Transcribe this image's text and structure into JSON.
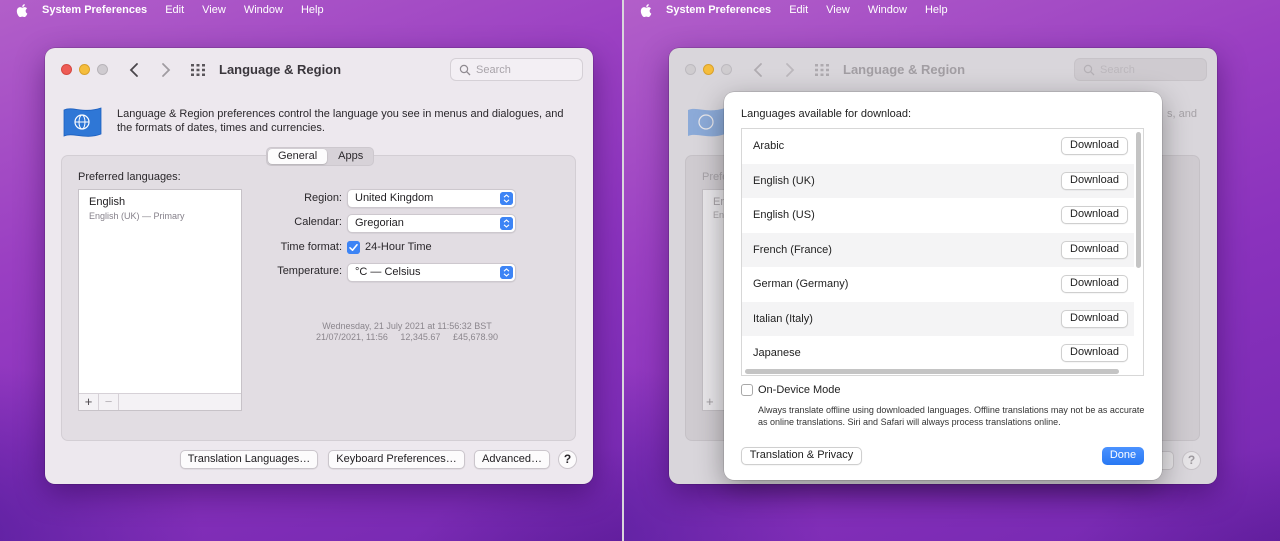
{
  "menubar": {
    "app_name": "System Preferences",
    "items": [
      "Edit",
      "View",
      "Window",
      "Help"
    ]
  },
  "window": {
    "title": "Language & Region",
    "search_placeholder": "Search",
    "description": "Language & Region preferences control the language you see in menus and dialogues, and the formats of dates, times and currencies.",
    "tabs": [
      "General",
      "Apps"
    ],
    "active_tab": "General",
    "preferred_label": "Preferred languages:",
    "languages": [
      {
        "name": "English",
        "detail": "English (UK) — Primary"
      }
    ],
    "add_symbol": "+",
    "remove_symbol": "−",
    "region_label": "Region:",
    "region_value": "United Kingdom",
    "calendar_label": "Calendar:",
    "calendar_value": "Gregorian",
    "time_label": "Time format:",
    "time_value": "24-Hour Time",
    "time_checked": true,
    "temp_label": "Temperature:",
    "temp_value": "°C — Celsius",
    "date_long": "Wednesday, 21 July 2021 at 11:56:32 BST",
    "date_short": "21/07/2021, 11:56     12,345.67     £45,678.90",
    "buttons": [
      "Translation Languages…",
      "Keyboard Preferences…",
      "Advanced…"
    ],
    "help": "?"
  },
  "background_window": {
    "title": "Language & Region",
    "search_placeholder": "Search",
    "desc_fragment": "s, and",
    "pref_fragment": "Prefe",
    "list_fragment_1": "En",
    "list_fragment_2": "En",
    "help": "?"
  },
  "sheet": {
    "title": "Languages available for download:",
    "download_label": "Download",
    "languages": [
      "Arabic",
      "English (UK)",
      "English (US)",
      "French (France)",
      "German (Germany)",
      "Italian (Italy)",
      "Japanese"
    ],
    "on_device_label": "On-Device Mode",
    "on_device_desc": "Always translate offline using downloaded languages. Offline translations may not be as accurate as online translations. Siri and Safari will always process translations online.",
    "translation_privacy": "Translation & Privacy",
    "done": "Done"
  },
  "colors": {
    "accent": "#3d84f5",
    "close": "#ee5b55",
    "minimize": "#f5bd3c"
  },
  "icons": [
    "apple-icon",
    "chevron-left-icon",
    "chevron-right-icon",
    "grid-icon",
    "search-icon",
    "flag-icon",
    "chevron-updown-icon",
    "checkmark-icon"
  ]
}
